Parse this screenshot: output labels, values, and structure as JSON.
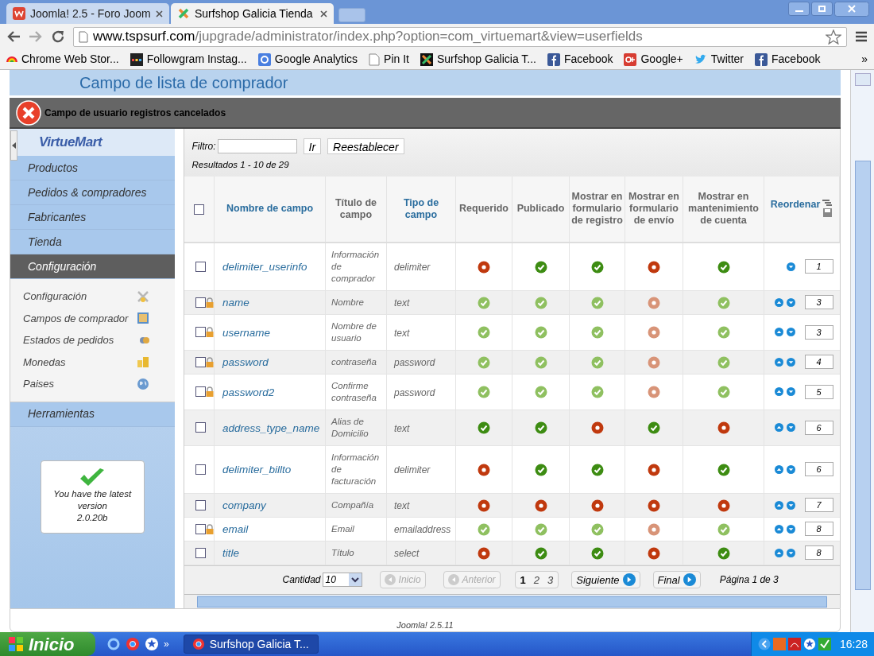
{
  "browser": {
    "tabs": [
      {
        "title": "Joomla! 2.5 - Foro Joom",
        "kind": "joomla",
        "selected": false
      },
      {
        "title": "Surfshop Galicia Tienda",
        "kind": "surfshop",
        "selected": true
      }
    ],
    "url": {
      "host": "www.tspsurf.com",
      "path": "/jupgrade/administrator/index.php?option=com_virtuemart&view=userfields"
    },
    "bookmarks": [
      {
        "label": "Chrome Web Stor...",
        "kind": "store"
      },
      {
        "label": "Followgram Instag...",
        "kind": "followgram"
      },
      {
        "label": "Google Analytics",
        "kind": "analytics"
      },
      {
        "label": "Pin It",
        "kind": "page"
      },
      {
        "label": "Surfshop Galicia T...",
        "kind": "surfshop"
      },
      {
        "label": "Facebook",
        "kind": "facebook"
      },
      {
        "label": "Google+",
        "kind": "gplus"
      },
      {
        "label": "Twitter",
        "kind": "twitter"
      },
      {
        "label": "Facebook",
        "kind": "facebook"
      }
    ],
    "bookmarks_more": "»"
  },
  "page": {
    "title": "Campo de lista de comprador",
    "message": "Campo de usuario registros cancelados",
    "sidebar": {
      "logo": "VirtueMart",
      "items": [
        {
          "label": "Productos",
          "selected": false
        },
        {
          "label": "Pedidos & compradores",
          "selected": false
        },
        {
          "label": "Fabricantes",
          "selected": false
        },
        {
          "label": "Tienda",
          "selected": false
        },
        {
          "label": "Configuración",
          "selected": true,
          "children": [
            {
              "label": "Configuración",
              "kind": "tools"
            },
            {
              "label": "Campos de comprador",
              "kind": "fields"
            },
            {
              "label": "Estados de pedidos",
              "kind": "status"
            },
            {
              "label": "Monedas",
              "kind": "coins"
            },
            {
              "label": "Paises",
              "kind": "globe"
            }
          ]
        },
        {
          "label": "Herramientas",
          "selected": false
        }
      ],
      "version": {
        "message": "You have the latest version",
        "number": "2.0.20b"
      }
    },
    "filter": {
      "label": "Filtro:",
      "buttons": [
        "Ir",
        "Reestablecer"
      ],
      "results": "Resultados 1 - 10 de 29"
    },
    "table": {
      "columns": [
        {
          "label": "Nombre de campo",
          "sortable": true
        },
        {
          "label": "Título de campo",
          "sortable": false
        },
        {
          "label": "Tipo de campo",
          "sortable": true
        },
        {
          "label": "Requerido",
          "sortable": false
        },
        {
          "label": "Publicado",
          "sortable": false
        },
        {
          "label": "Mostrar en formulario de registro",
          "sortable": false
        },
        {
          "label": "Mostrar en formulario de envío",
          "sortable": false
        },
        {
          "label": "Mostrar en mantenimiento de cuenta",
          "sortable": false
        },
        {
          "label": "Reordenar",
          "sortable": true
        }
      ],
      "select_all": {
        "checked": false
      },
      "rows": [
        {
          "checked": false,
          "locked": false,
          "name": "delimiter_userinfo",
          "title": "Información de comprador",
          "type": "delimiter",
          "flags": [
            false,
            true,
            true,
            false,
            true
          ],
          "can_move_up": false,
          "order": "1"
        },
        {
          "checked": false,
          "locked": true,
          "name": "name",
          "title": "Nombre",
          "type": "text",
          "flags": [
            true,
            true,
            true,
            false,
            true
          ],
          "can_move_up": true,
          "order": "3"
        },
        {
          "checked": false,
          "locked": true,
          "name": "username",
          "title": "Nombre de usuario",
          "type": "text",
          "flags": [
            true,
            true,
            true,
            false,
            true
          ],
          "can_move_up": true,
          "order": "3"
        },
        {
          "checked": false,
          "locked": true,
          "name": "password",
          "title": "contraseña",
          "type": "password",
          "flags": [
            true,
            true,
            true,
            false,
            true
          ],
          "can_move_up": true,
          "order": "4"
        },
        {
          "checked": false,
          "locked": true,
          "name": "password2",
          "title": "Confirme contraseña",
          "type": "password",
          "flags": [
            true,
            true,
            true,
            false,
            true
          ],
          "can_move_up": true,
          "order": "5"
        },
        {
          "checked": false,
          "locked": false,
          "name": "address_type_name",
          "title": "Alias de Domicilio",
          "type": "text",
          "flags": [
            true,
            true,
            false,
            true,
            false
          ],
          "can_move_up": true,
          "order": "6"
        },
        {
          "checked": false,
          "locked": false,
          "name": "delimiter_billto",
          "title": "Información de facturación",
          "type": "delimiter",
          "flags": [
            false,
            true,
            true,
            false,
            true
          ],
          "can_move_up": true,
          "order": "6"
        },
        {
          "checked": false,
          "locked": false,
          "name": "company",
          "title": "Compañía",
          "type": "text",
          "flags": [
            false,
            false,
            false,
            false,
            false
          ],
          "can_move_up": true,
          "order": "7"
        },
        {
          "checked": false,
          "locked": true,
          "name": "email",
          "title": "Email",
          "type": "emailaddress",
          "flags": [
            true,
            true,
            true,
            false,
            true
          ],
          "can_move_up": true,
          "order": "8"
        },
        {
          "checked": false,
          "locked": false,
          "name": "title",
          "title": "Título",
          "type": "select",
          "flags": [
            false,
            true,
            true,
            false,
            true
          ],
          "can_move_up": true,
          "order": "8"
        }
      ]
    },
    "pagination": {
      "limit_label": "Cantidad",
      "limit": "10",
      "nav": [
        {
          "label": "Inicio",
          "kind": "prev",
          "disabled": true
        },
        {
          "label": "Anterior",
          "kind": "prev",
          "disabled": true
        }
      ],
      "pages": [
        {
          "label": "1",
          "selected": true
        },
        {
          "label": "2",
          "selected": false
        },
        {
          "label": "3",
          "selected": false
        }
      ],
      "nav_next": [
        {
          "label": "Siguiente",
          "disabled": false
        },
        {
          "label": "Final",
          "disabled": false
        }
      ],
      "summary": "Página 1 de 3"
    },
    "footer": "Joomla! 2.5.11"
  },
  "taskbar": {
    "start": "Inicio",
    "more": "»",
    "tasks": [
      {
        "label": "Surfshop Galicia T...",
        "selected": true
      }
    ],
    "clock": "16:28"
  }
}
